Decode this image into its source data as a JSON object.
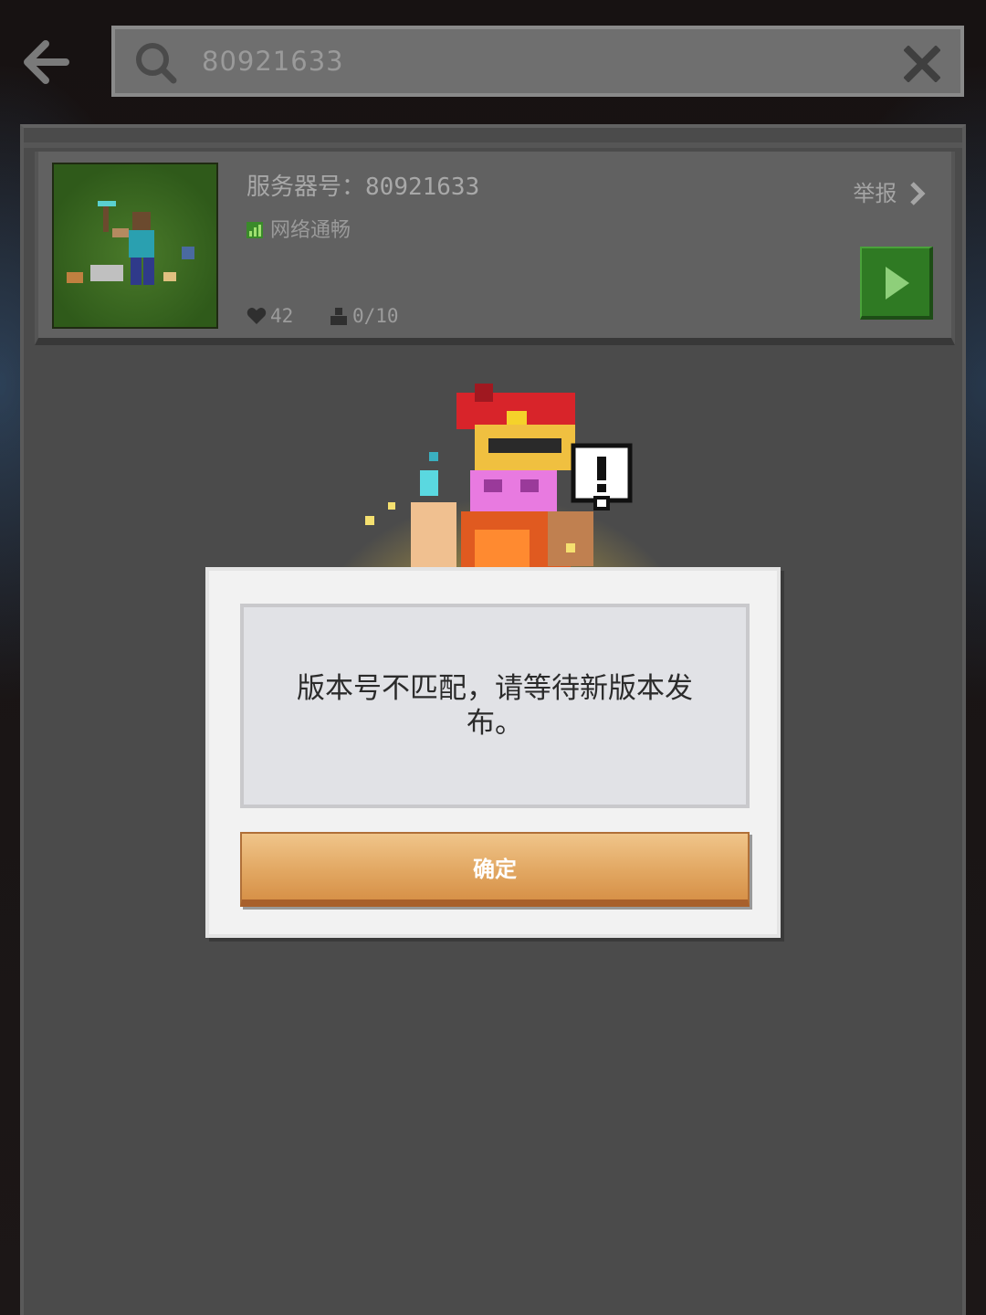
{
  "search": {
    "value": "80921633"
  },
  "server": {
    "id_label": "服务器号：",
    "id_value": "80921633",
    "network_status": "网络通畅",
    "report_label": "举报",
    "likes": "42",
    "players": "0/10"
  },
  "dialog": {
    "message": "版本号不匹配，请等待新版本发布。",
    "confirm_label": "确定"
  },
  "colors": {
    "play_button": "#2f7a23",
    "confirm_button": "#e2a863",
    "panel": "#4b4b4b"
  },
  "icons": [
    "back-arrow-icon",
    "search-icon",
    "close-icon",
    "signal-icon",
    "chevron-right-icon",
    "play-icon",
    "heart-icon",
    "person-icon"
  ]
}
